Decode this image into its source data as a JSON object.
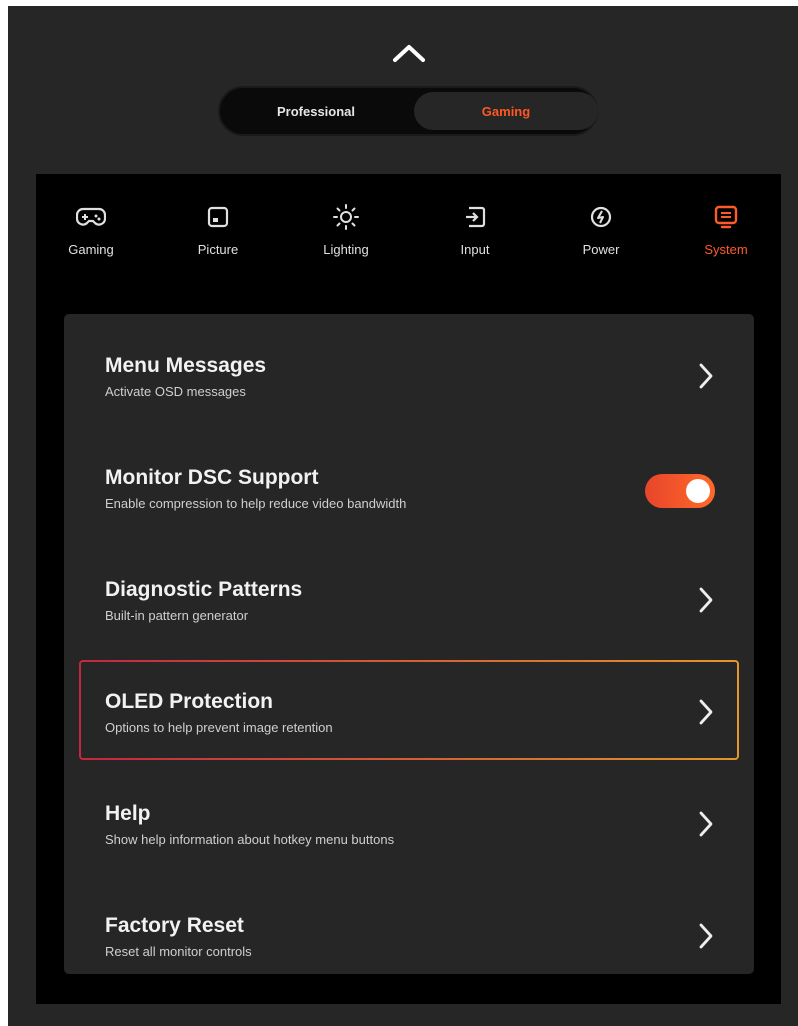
{
  "header": {
    "collapse_icon": "chevron-up-icon"
  },
  "mode_toggle": {
    "professional": "Professional",
    "gaming": "Gaming",
    "selected": "Gaming"
  },
  "categories": [
    {
      "label": "Gaming",
      "icon": "gamepad-icon"
    },
    {
      "label": "Picture",
      "icon": "picture-icon"
    },
    {
      "label": "Lighting",
      "icon": "lighting-icon"
    },
    {
      "label": "Input",
      "icon": "input-icon"
    },
    {
      "label": "Power",
      "icon": "power-icon"
    },
    {
      "label": "System",
      "icon": "system-icon",
      "active": true
    }
  ],
  "settings": [
    {
      "title": "Menu Messages",
      "subtitle": "Activate OSD messages",
      "control": "chevron"
    },
    {
      "title": "Monitor DSC Support",
      "subtitle": "Enable compression to help reduce video bandwidth",
      "control": "toggle",
      "toggle_on": true
    },
    {
      "title": "Diagnostic Patterns",
      "subtitle": "Built-in pattern generator",
      "control": "chevron"
    },
    {
      "title": "OLED Protection",
      "subtitle": "Options to help prevent image retention",
      "control": "chevron",
      "selected": true
    },
    {
      "title": "Help",
      "subtitle": "Show help information about hotkey menu buttons",
      "control": "chevron"
    },
    {
      "title": "Factory Reset",
      "subtitle": "Reset all monitor controls",
      "control": "chevron"
    }
  ],
  "colors": {
    "accent": "#ff5722",
    "toggle_on": "#f0522a",
    "selected_border_start": "#c3273f",
    "selected_border_end": "#e4962b"
  }
}
